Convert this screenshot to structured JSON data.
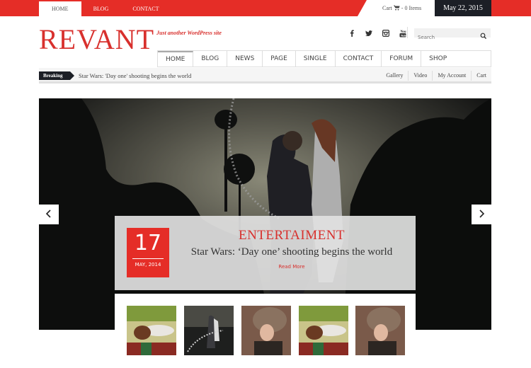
{
  "topbar": {
    "nav": [
      {
        "label": "HOME",
        "active": true
      },
      {
        "label": "BLOG",
        "active": false
      },
      {
        "label": "CONTACT",
        "active": false
      }
    ],
    "cart_label": "Cart",
    "cart_items": "- 0 Items",
    "date": "May 22, 2015"
  },
  "header": {
    "logo": "REVANT",
    "tagline": "Just another WordPress site",
    "social": [
      "facebook-icon",
      "twitter-icon",
      "instagram-icon",
      "youtube-icon"
    ],
    "search_placeholder": "Search"
  },
  "mainnav": {
    "items": [
      {
        "label": "HOME",
        "active": true
      },
      {
        "label": "BLOG"
      },
      {
        "label": "NEWS"
      },
      {
        "label": "PAGE"
      },
      {
        "label": "SINGLE"
      },
      {
        "label": "CONTACT"
      },
      {
        "label": "FORUM"
      },
      {
        "label": "SHOP"
      }
    ]
  },
  "breaking": {
    "label": "Breaking",
    "text": "Star Wars: 'Day one' shooting begins the world",
    "links": [
      "Gallery",
      "Video",
      "My Account",
      "Cart"
    ]
  },
  "slider": {
    "date_day": "17",
    "date_month": "MAY, 2014",
    "category": "ENTERTAIMENT",
    "headline": "Star Wars: ‘Day one’ shooting begins the world",
    "read_more": "Read More",
    "prev_icon": "chevron-left-icon",
    "next_icon": "chevron-right-icon"
  },
  "thumbnails": [
    {
      "subject": "woman lying on blanket"
    },
    {
      "subject": "couple embracing at dusk"
    },
    {
      "subject": "woman in fur hat"
    },
    {
      "subject": "woman lying on blanket"
    },
    {
      "subject": "woman in fur hat"
    }
  ],
  "colors": {
    "brand_red": "#e52d27",
    "dark": "#1c1f26"
  }
}
